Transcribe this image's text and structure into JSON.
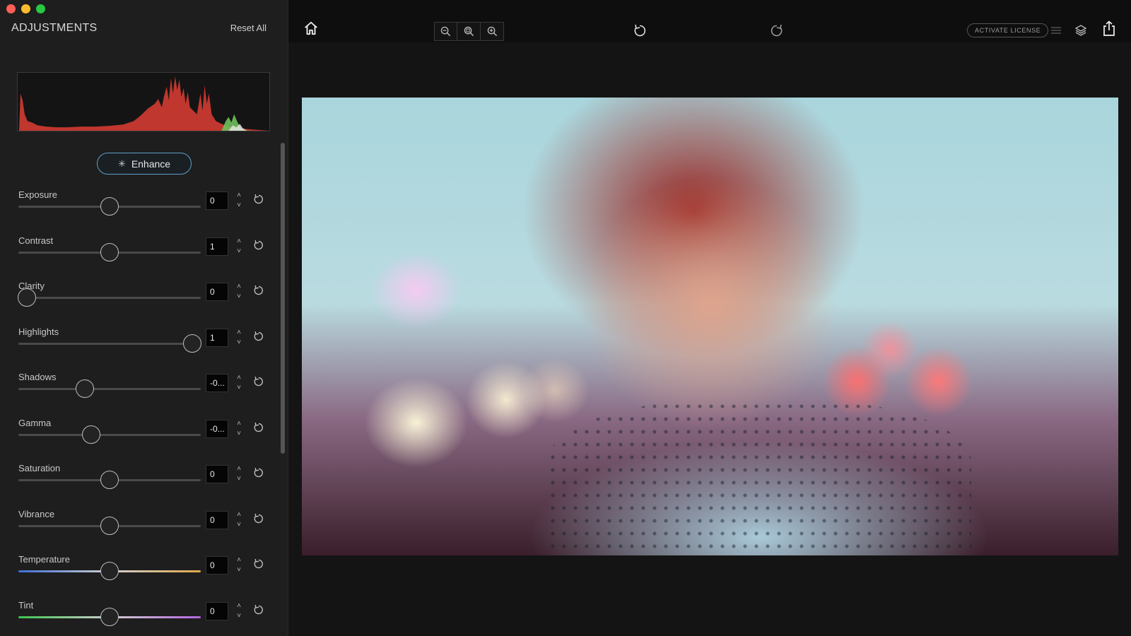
{
  "sidebar": {
    "title": "ADJUSTMENTS",
    "reset_all": "Reset All",
    "enhance_label": "Enhance",
    "adjustments": [
      {
        "label": "Exposure",
        "value": "0",
        "position": 0.5,
        "track": "plain"
      },
      {
        "label": "Contrast",
        "value": "1",
        "position": 0.5,
        "track": "plain"
      },
      {
        "label": "Clarity",
        "value": "0",
        "position": 0.0,
        "track": "plain"
      },
      {
        "label": "Highlights",
        "value": "1",
        "position": 1.0,
        "track": "plain"
      },
      {
        "label": "Shadows",
        "value": "-0...",
        "position": 0.35,
        "track": "plain"
      },
      {
        "label": "Gamma",
        "value": "-0...",
        "position": 0.39,
        "track": "plain"
      },
      {
        "label": "Saturation",
        "value": "0",
        "position": 0.5,
        "track": "plain"
      },
      {
        "label": "Vibrance",
        "value": "0",
        "position": 0.5,
        "track": "plain"
      },
      {
        "label": "Temperature",
        "value": "0",
        "position": 0.5,
        "track": "temp"
      },
      {
        "label": "Tint",
        "value": "0",
        "position": 0.5,
        "track": "tint"
      }
    ]
  },
  "toolbar": {
    "activate_license": "ACTIVATE LICENSE",
    "icons": [
      "home-icon",
      "zoom-out-icon",
      "zoom-fit-icon",
      "zoom-in-icon",
      "undo-icon",
      "redo-icon",
      "list-icon",
      "layers-icon",
      "share-icon"
    ]
  },
  "colors": {
    "accent": "#5fa0c8",
    "sidebar_bg": "#1e1e1e",
    "toolbar_bg": "#0e0e0e",
    "histogram_red": "#c8392f"
  }
}
